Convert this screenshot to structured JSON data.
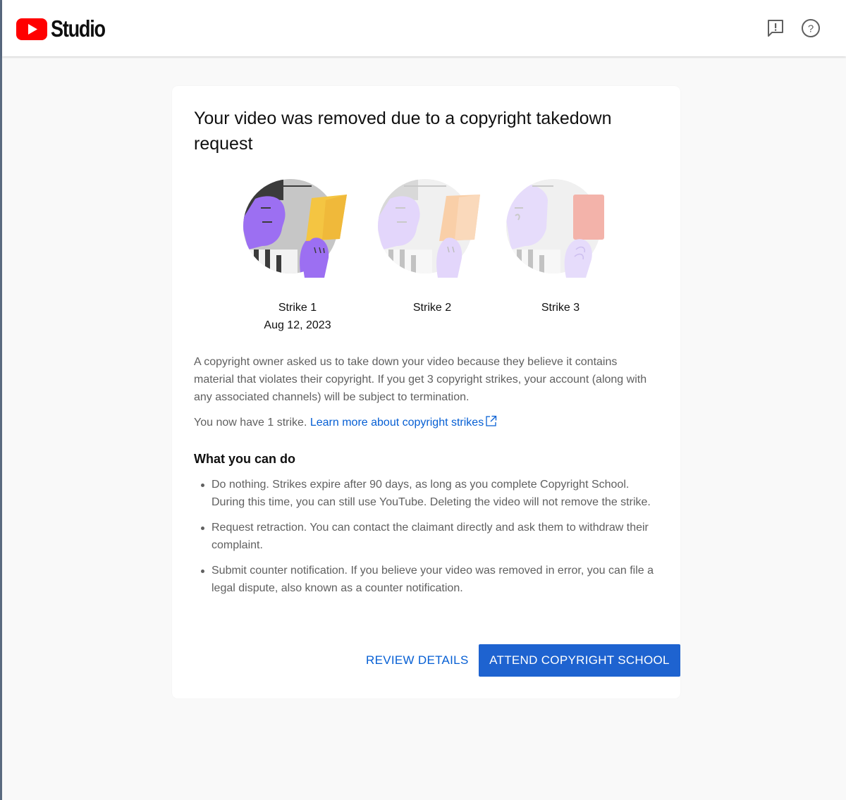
{
  "header": {
    "logo_text": "Studio",
    "feedback_icon": "feedback-icon",
    "help_icon": "help-icon",
    "help_glyph": "?"
  },
  "card": {
    "title": "Your video was removed due to a copyright takedown request",
    "strikes": [
      {
        "label": "Strike 1",
        "date": "Aug 12, 2023",
        "active": true
      },
      {
        "label": "Strike 2",
        "date": "",
        "active": false
      },
      {
        "label": "Strike 3",
        "date": "",
        "active": false
      }
    ],
    "description": "A copyright owner asked us to take down your video because they believe it contains material that violates their copyright. If you get 3 copyright strikes, your account (along with any associated channels) will be subject to termination.",
    "strike_count_text": "You now have 1 strike.",
    "learn_more_link": "Learn more about copyright strikes",
    "what_you_can_do_heading": "What you can do",
    "options": [
      "Do nothing. Strikes expire after 90 days, as long as you complete Copyright School. During this time, you can still use YouTube. Deleting the video will not remove the strike.",
      "Request retraction. You can contact the claimant directly and ask them to withdraw their complaint.",
      "Submit counter notification. If you believe your video was removed in error, you can file a legal dispute, also known as a counter notification."
    ],
    "review_details_label": "REVIEW DETAILS",
    "attend_school_label": "ATTEND COPYRIGHT SCHOOL"
  },
  "colors": {
    "youtube_red": "#ff0000",
    "link_blue": "#065fd4",
    "primary_button": "#1e63d0",
    "strike1_card": "#f4c542",
    "strike2_card": "#f9cfa8",
    "strike3_card": "#f3b3aa",
    "person_purple": "#9c6ff2"
  }
}
